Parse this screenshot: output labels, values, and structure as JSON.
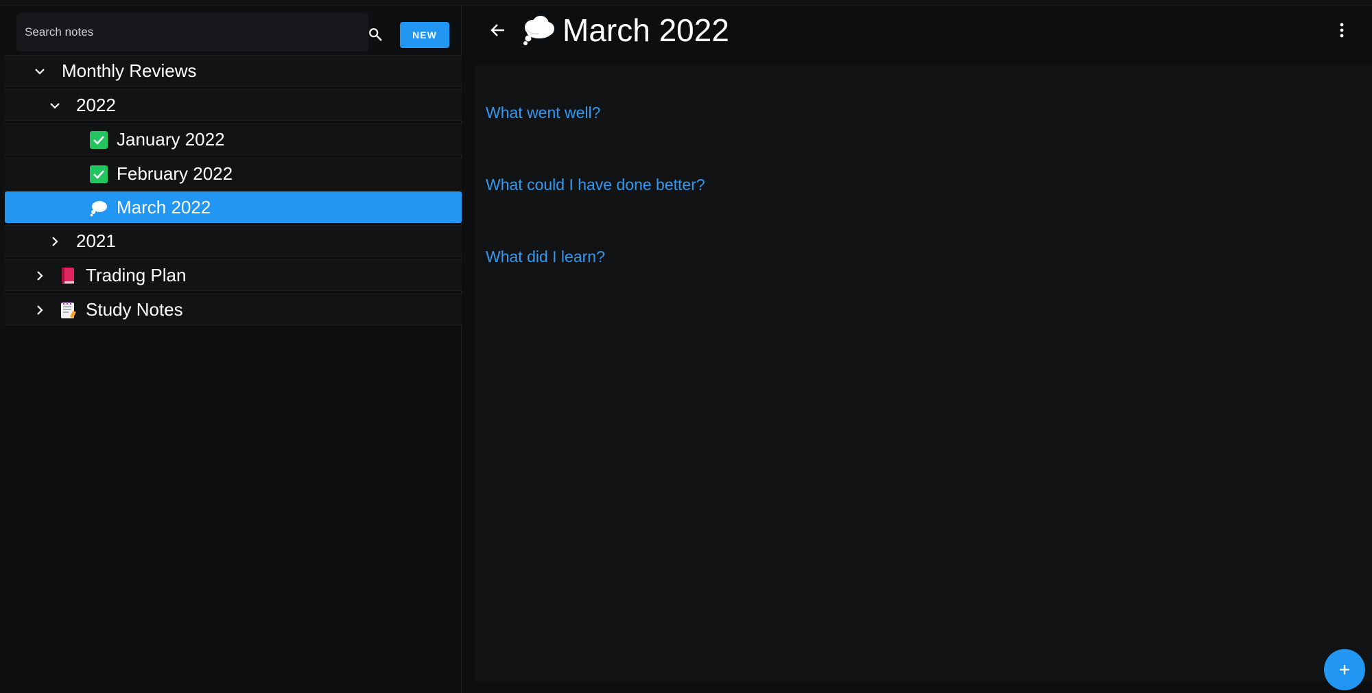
{
  "search": {
    "placeholder": "Search notes",
    "value": ""
  },
  "toolbar": {
    "new_label": "NEW"
  },
  "tree": {
    "monthly_reviews": "Monthly Reviews",
    "year_2022": "2022",
    "january": "January 2022",
    "february": "February 2022",
    "march": "March 2022",
    "year_2021": "2021",
    "trading_plan": "Trading Plan",
    "study_notes": "Study Notes"
  },
  "note": {
    "title": "March 2022",
    "headings": [
      "What went well?",
      "What could I have done better?",
      "What did I learn?"
    ]
  },
  "icons": {
    "search": "search-icon",
    "back": "arrow-left-icon",
    "more": "more-vertical-icon",
    "fab": "plus-icon",
    "january_status": "check-box-icon",
    "february_status": "check-box-icon",
    "march_status": "thought-cloud-icon",
    "trading_plan": "red-book-icon",
    "study_notes": "notepad-icon"
  },
  "colors": {
    "accent": "#2196f3",
    "link": "#3399f0",
    "check": "#22c55e",
    "background": "#0d0e10"
  }
}
